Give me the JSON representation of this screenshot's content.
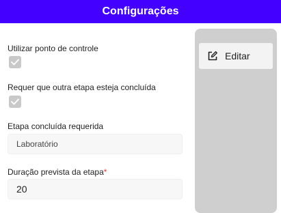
{
  "header": {
    "title": "Configurações"
  },
  "form": {
    "checkpoint": {
      "label": "Utilizar ponto de controle",
      "checked": true
    },
    "requires_stage": {
      "label": "Requer que outra etapa esteja concluída",
      "checked": true
    },
    "required_stage": {
      "label": "Etapa concluída requerida",
      "value": "Laboratório"
    },
    "duration": {
      "label": "Duração prevista da etapa",
      "required_marker": "*",
      "value": "20"
    }
  },
  "side_panel": {
    "edit_label": "Editar",
    "edit_icon": "edit-icon"
  },
  "colors": {
    "header_bg": "#4400ff",
    "panel_bg": "#cfcfcf",
    "required": "#e53935"
  }
}
